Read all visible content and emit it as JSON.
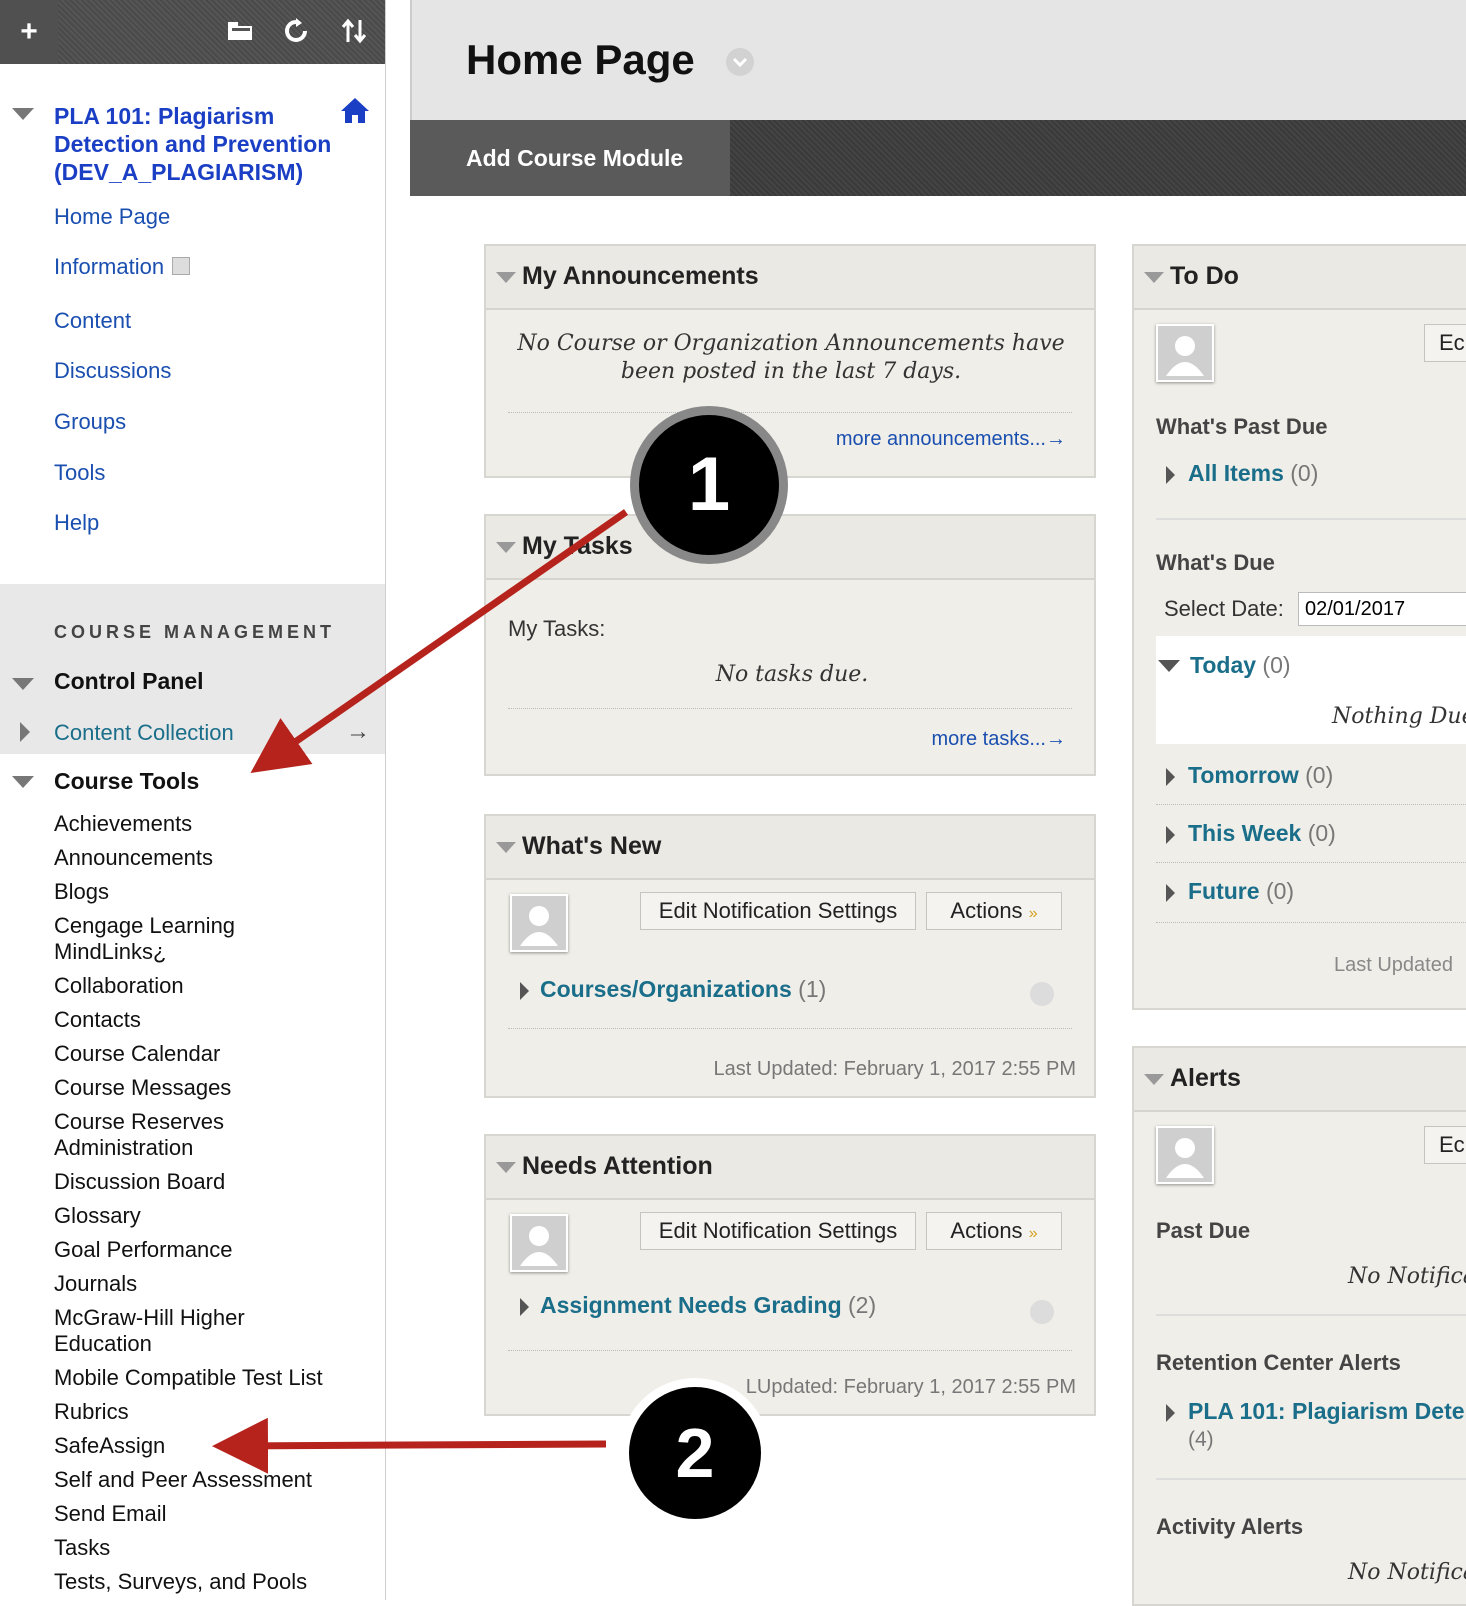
{
  "sidebar": {
    "toolbar": {
      "add": "+",
      "folder": "folder-icon",
      "refresh": "refresh-icon",
      "sort": "sort-icon"
    },
    "course_title": "PLA 101: Plagiarism Detection and Prevention (DEV_A_PLAGIARISM)",
    "nav": [
      "Home Page",
      "Information",
      "Content",
      "Discussions",
      "Groups",
      "Tools",
      "Help"
    ],
    "course_management_label": "COURSE MANAGEMENT",
    "control_panel": "Control Panel",
    "content_collection": "Content Collection",
    "content_collection_arrow": "→",
    "course_tools": "Course Tools",
    "tools": [
      "Achievements",
      "Announcements",
      "Blogs",
      "Cengage Learning MindLinks¿",
      "Collaboration",
      "Contacts",
      "Course Calendar",
      "Course Messages",
      "Course Reserves Administration",
      "Discussion Board",
      "Glossary",
      "Goal Performance",
      "Journals",
      "McGraw-Hill Higher Education",
      "Mobile Compatible Test List",
      "Rubrics",
      "SafeAssign",
      "Self and Peer Assessment",
      "Send Email",
      "Tasks",
      "Tests, Surveys, and Pools"
    ]
  },
  "header": {
    "title": "Home Page",
    "add_module": "Add Course Module"
  },
  "announcements": {
    "title": "My Announcements",
    "message": "No Course or Organization Announcements have been posted in the last 7 days.",
    "more": "more announcements...→"
  },
  "tasks": {
    "title": "My Tasks",
    "label": "My Tasks:",
    "message": "No tasks due.",
    "more": "more tasks...→"
  },
  "whats_new": {
    "title": "What's New",
    "edit": "Edit Notification Settings",
    "actions": "Actions",
    "item": "Courses/Organizations",
    "item_count": "(1)",
    "updated": "Last Updated: February 1, 2017 2:55 PM"
  },
  "needs_attention": {
    "title": "Needs Attention",
    "edit": "Edit Notification Settings",
    "actions": "Actions",
    "item": "Assignment Needs Grading",
    "item_count": "(2)",
    "updated": "Updated: February 1, 2017 2:55 PM",
    "updated_prefix": "L"
  },
  "todo": {
    "title": "To Do",
    "edit_partial": "Ec",
    "past_due_label": "What's Past Due",
    "all_items": "All Items",
    "all_items_count": "(0)",
    "whats_due_label": "What's Due",
    "select_date_label": "Select Date:",
    "date_value": "02/01/2017",
    "today": "Today",
    "today_count": "(0)",
    "nothing_due": "Nothing Due",
    "tomorrow": "Tomorrow",
    "tomorrow_count": "(0)",
    "this_week": "This Week",
    "this_week_count": "(0)",
    "future": "Future",
    "future_count": "(0)",
    "last_updated": "Last Updated"
  },
  "alerts": {
    "title": "Alerts",
    "edit_partial": "Ec",
    "past_due": "Past Due",
    "no_notif": "No Notifica",
    "retention": "Retention Center Alerts",
    "course_link": "PLA 101: Plagiarism Dete",
    "course_count": "(4)",
    "activity": "Activity Alerts",
    "no_notif2": "No Notifica"
  },
  "callouts": [
    "1",
    "2"
  ],
  "colors": {
    "accent_link": "#1a4fb0",
    "teal": "#1a6e8a",
    "arrow": "#b5231c"
  }
}
